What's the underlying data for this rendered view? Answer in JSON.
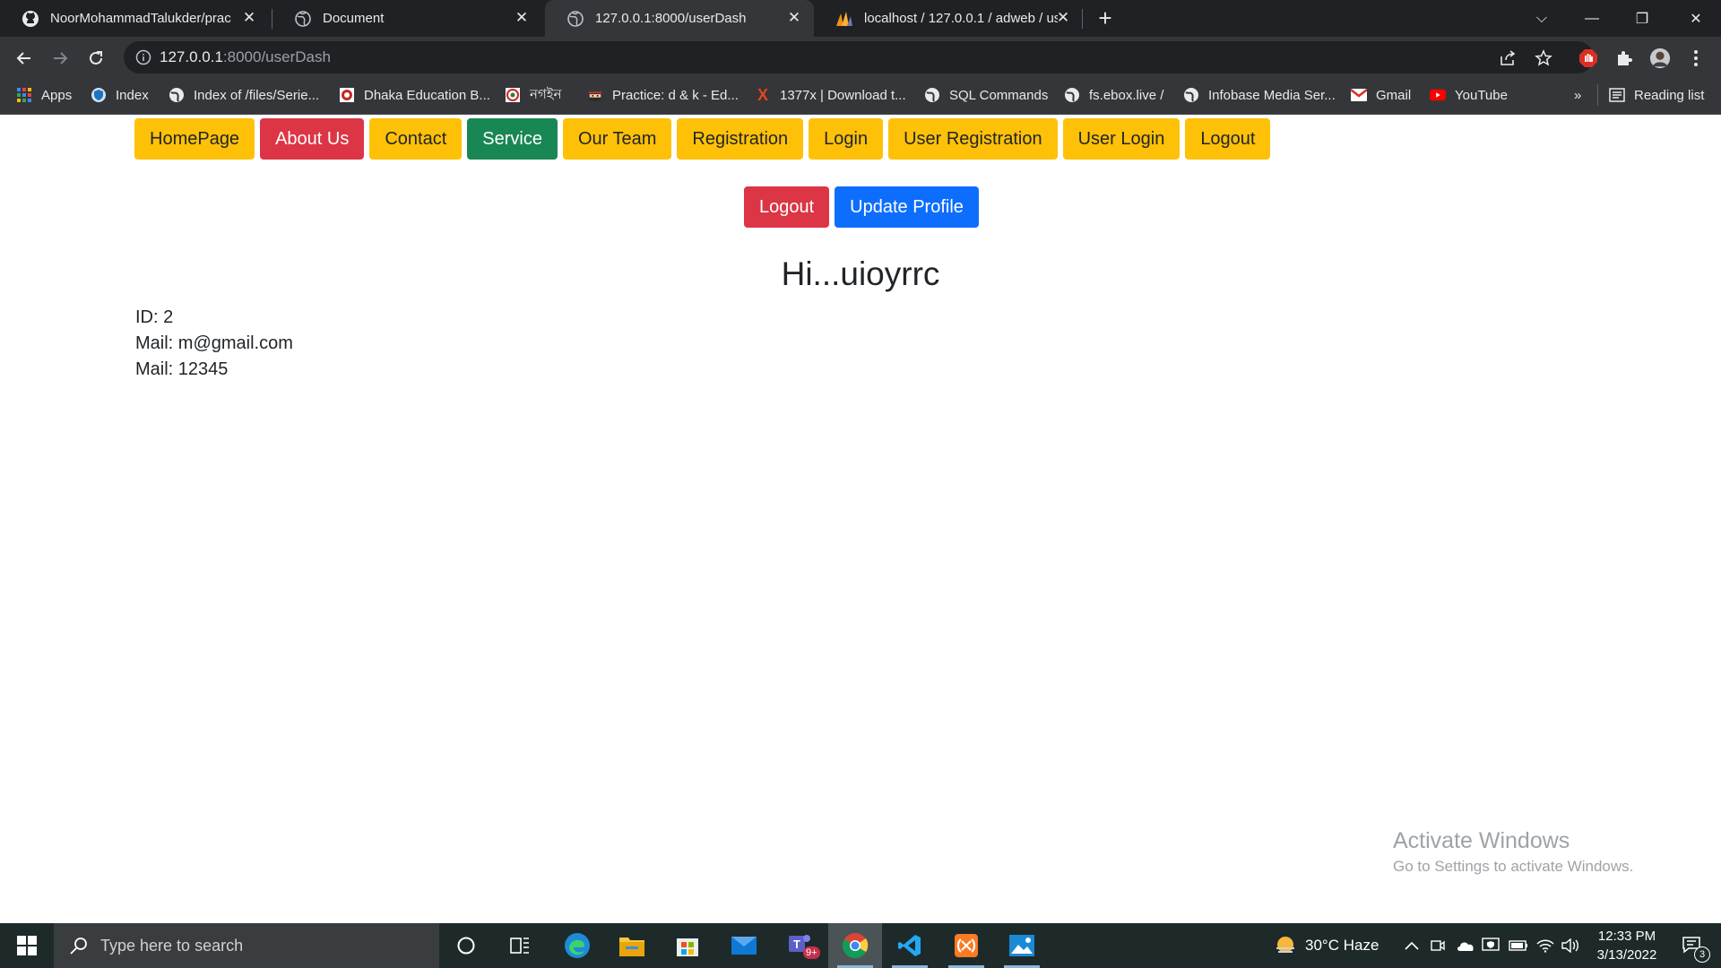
{
  "browser": {
    "tabs": [
      {
        "title": "NoorMohammadTalukder/prac",
        "icon": "github-icon"
      },
      {
        "title": "Document",
        "icon": "globe-icon"
      },
      {
        "title": "127.0.0.1:8000/userDash",
        "icon": "globe-icon",
        "active": true
      },
      {
        "title": "localhost / 127.0.0.1 / adweb / us",
        "icon": "phpmyadmin-icon"
      }
    ],
    "url_host": "127.0.0.1",
    "url_path": ":8000/userDash",
    "bookmarks": [
      {
        "label": "Apps",
        "icon": "apps-grid-icon"
      },
      {
        "label": "Index",
        "icon": "shield-icon"
      },
      {
        "label": "Index of /files/Serie...",
        "icon": "globe-icon"
      },
      {
        "label": "Dhaka Education B...",
        "icon": "education-board-icon"
      },
      {
        "label": "নগইন",
        "icon": "board-seal-icon"
      },
      {
        "label": "Practice: d & k - Ed...",
        "icon": "ninja-icon"
      },
      {
        "label": "1377x | Download t...",
        "icon": "x-logo-icon"
      },
      {
        "label": "SQL Commands",
        "icon": "globe-icon"
      },
      {
        "label": "fs.ebox.live /",
        "icon": "globe-icon"
      },
      {
        "label": "Infobase Media Ser...",
        "icon": "globe-icon"
      },
      {
        "label": "Gmail",
        "icon": "gmail-icon"
      },
      {
        "label": "YouTube",
        "icon": "youtube-icon"
      }
    ],
    "more_bookmarks": "»",
    "reading_list": "Reading list"
  },
  "page": {
    "nav": [
      {
        "label": "HomePage",
        "color": "#ffc107"
      },
      {
        "label": "About Us",
        "color": "#dc3545"
      },
      {
        "label": "Contact",
        "color": "#ffc107"
      },
      {
        "label": "Service",
        "color": "#198754"
      },
      {
        "label": "Our Team",
        "color": "#ffc107"
      },
      {
        "label": "Registration",
        "color": "#ffc107"
      },
      {
        "label": "Login",
        "color": "#ffc107"
      },
      {
        "label": "User Registration",
        "color": "#ffc107"
      },
      {
        "label": "User Login",
        "color": "#ffc107"
      },
      {
        "label": "Logout",
        "color": "#ffc107"
      }
    ],
    "actions": {
      "logout": "Logout",
      "update_profile": "Update Profile"
    },
    "greeting": "Hi...uioyrrc",
    "details": {
      "id": "ID: 2",
      "mail": "Mail: m@gmail.com",
      "mail2": "Mail: 12345"
    }
  },
  "watermark": {
    "title": "Activate Windows",
    "subtitle": "Go to Settings to activate Windows."
  },
  "taskbar": {
    "search_placeholder": "Type here to search",
    "teams_badge": "9+",
    "weather": "30°C  Haze",
    "time": "12:33 PM",
    "date": "3/13/2022",
    "notifications": "3"
  }
}
